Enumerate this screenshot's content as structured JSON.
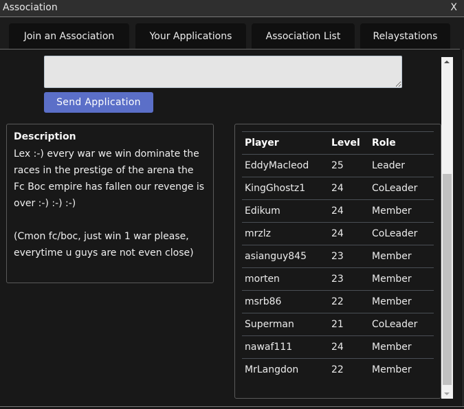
{
  "window": {
    "title": "Association",
    "close_label": "X"
  },
  "tabs": [
    {
      "label": "Join an Association"
    },
    {
      "label": "Your Applications"
    },
    {
      "label": "Association List"
    },
    {
      "label": "Relaystations"
    }
  ],
  "application": {
    "textarea_value": "",
    "send_label": "Send Application"
  },
  "description": {
    "title": "Description",
    "text": "Lex :-) every war we win dominate the races in the prestige of the arena the Fc Boc empire has fallen our revenge is over :-) :-) :-)\n\n(Cmon fc/boc, just win 1 war please, everytime u guys are not even close)"
  },
  "members": {
    "headers": {
      "player": "Player",
      "level": "Level",
      "role": "Role"
    },
    "rows": [
      {
        "player": "EddyMacleod",
        "level": "25",
        "role": "Leader"
      },
      {
        "player": "KingGhostz1",
        "level": "24",
        "role": "CoLeader"
      },
      {
        "player": "Edikum",
        "level": "24",
        "role": "Member"
      },
      {
        "player": "mrzlz",
        "level": "24",
        "role": "CoLeader"
      },
      {
        "player": "asianguy845",
        "level": "23",
        "role": "Member"
      },
      {
        "player": "morten",
        "level": "23",
        "role": "Member"
      },
      {
        "player": "msrb86",
        "level": "22",
        "role": "Member"
      },
      {
        "player": "Superman",
        "level": "21",
        "role": "CoLeader"
      },
      {
        "player": "nawaf111",
        "level": "24",
        "role": "Member"
      },
      {
        "player": "MrLangdon",
        "level": "22",
        "role": "Member"
      }
    ]
  },
  "scrollbar": {
    "up_icon": "triangle-up",
    "down_icon": "triangle-down"
  }
}
